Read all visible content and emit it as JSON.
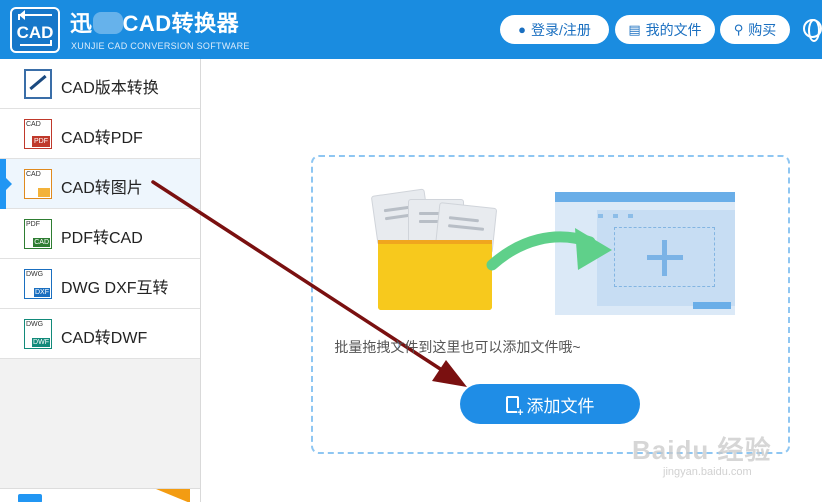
{
  "header": {
    "title_suffix": "CAD转换器",
    "title_prefix": "迅",
    "subtitle": "XUNJIE CAD CONVERSION SOFTWARE",
    "logo_text": "CAD",
    "login_label": "登录/注册",
    "my_files_label": "我的文件",
    "buy_label": "购买",
    "icons": {
      "login": "user-icon",
      "files": "document-icon",
      "buy": "cart-icon",
      "language": "globe-icon"
    }
  },
  "sidebar": {
    "items": [
      {
        "label": "CAD版本转换",
        "icon": "cad-version-icon",
        "tag": "",
        "tag2": ""
      },
      {
        "label": "CAD转PDF",
        "icon": "cad-to-pdf-icon",
        "tag": "CAD",
        "tag2": "PDF"
      },
      {
        "label": "CAD转图片",
        "icon": "cad-to-image-icon",
        "tag": "CAD",
        "tag2": ""
      },
      {
        "label": "PDF转CAD",
        "icon": "pdf-to-cad-icon",
        "tag": "PDF",
        "tag2": "CAD"
      },
      {
        "label": "DWG DXF互转",
        "icon": "dwg-dxf-icon",
        "tag": "DWG",
        "tag2": "DXF"
      },
      {
        "label": "CAD转DWF",
        "icon": "cad-to-dwf-icon",
        "tag": "DWG",
        "tag2": "DWF"
      }
    ],
    "active_index": 2
  },
  "main": {
    "hint": "批量拖拽文件到这里也可以添加文件哦~",
    "add_button_label": "添加文件"
  },
  "watermark": {
    "main": "Baidu 经验",
    "sub": "jingyan.baidu.com"
  },
  "colors": {
    "header": "#1a8ce0",
    "accent": "#1f8de6",
    "annotation_arrow": "#7a1010"
  }
}
